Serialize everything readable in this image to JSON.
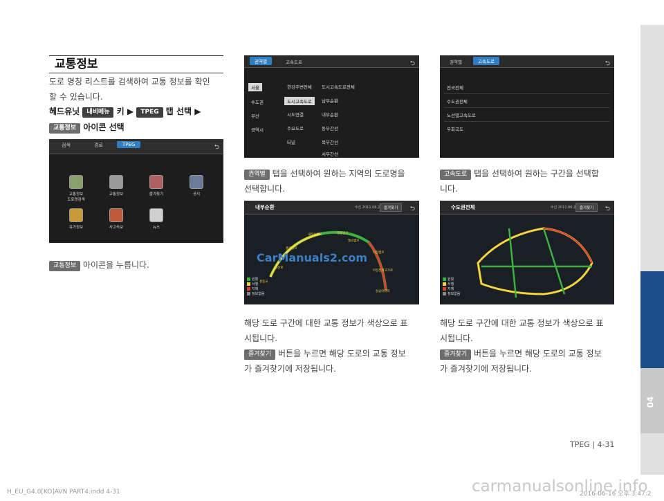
{
  "section_title": "교통정보",
  "intro": [
    "도로 명칭 리스트를 검색하여 교통 정보를 확인",
    "할 수 있습니다."
  ],
  "steps": {
    "line1_prefix": "헤드유닛",
    "tag_menu": "내비메뉴",
    "key": "키",
    "arrow": "▶",
    "tag_tpeg": "TPEG",
    "tab_select": "탭 선택",
    "tag_traffic": "교통정보",
    "icon_select": "아이콘 선택"
  },
  "screen1": {
    "tabs": [
      "검색",
      "경로",
      "TPEG"
    ],
    "back": "⮌",
    "items": [
      "교통정보\n도로명검색",
      "교통정보",
      "즐겨찾기",
      "공지",
      "유가정보",
      "사고속보",
      "뉴스"
    ]
  },
  "note_press": {
    "tag": "교통정보",
    "text": "아이콘을 누릅니다."
  },
  "screen2": {
    "tabs": [
      "권역별",
      "고속도로"
    ],
    "col1": [
      "서울",
      "수도권",
      "부산",
      "광역시"
    ],
    "col2": [
      "한강주변전체",
      "도시고속도로",
      "시도연결",
      "주요도로",
      "터널"
    ],
    "col3": [
      "도시고속도로전체",
      "남부순환",
      "내부순환",
      "동부간선",
      "북부간선",
      "서부간선"
    ]
  },
  "screen3": {
    "tabs": [
      "권역별",
      "고속도로"
    ],
    "list": [
      "전국전체",
      "수도권전체",
      "노선별고속도로",
      "우회국도"
    ]
  },
  "note_region": {
    "tag": "권역별",
    "lines": [
      "탭을 선택하여 원하는 지역의 도로명을",
      "선택합니다."
    ]
  },
  "note_highway": {
    "tag": "고속도로",
    "lines": [
      "탭을 선택하여 원하는 구간을 선택합",
      "니다."
    ]
  },
  "map_left": {
    "title": "내부순환",
    "time": "수신 2011.06.29 10:07",
    "fav": "즐겨찾기",
    "labels": [
      "내부순환로",
      "정릉입구",
      "월곡램프",
      "홍은램프",
      "마장램프",
      "성산로",
      "마장청계고가로",
      "성동교",
      "살곶이다리"
    ],
    "legend": [
      "원활",
      "서행",
      "지체",
      "정보없음"
    ]
  },
  "map_right": {
    "title": "수도권전체",
    "time": "수신 2011.06.29 10:07",
    "fav": "즐겨찾기",
    "legend": [
      "원활",
      "서행",
      "지체",
      "정보없음"
    ]
  },
  "desc": {
    "line1": "해당 도로 구간에 대한 교통 정보가 색상으로 표",
    "line2": "시됩니다.",
    "tag": "즐겨찾기",
    "line3": "버튼을 누르면 해당 도로의 교통 정보",
    "line4": "가 즐겨찾기에 저장됩니다."
  },
  "page_footer": "TPEG | 4-31",
  "chapter": "04",
  "imprint_left": "H_EU_G4.0[KO]AVN PART4.indd   4-31",
  "imprint_right": "2016-06-16  오후 3:47:2",
  "watermark": "carmanualsonline.info",
  "map_watermark": "CarManuals2.com",
  "colors": {
    "accent_blue": "#1c4e8a",
    "tab_blue": "#2f7fc1",
    "smooth": "#3cb043",
    "slow": "#f5d442",
    "jam": "#e23a2f"
  }
}
